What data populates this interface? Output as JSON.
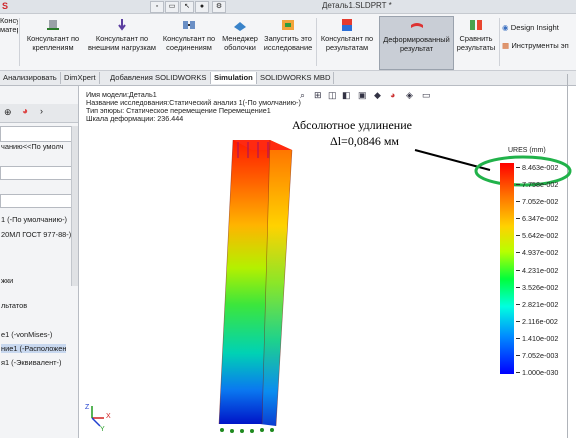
{
  "window": {
    "app_logo": "S",
    "title": "Деталь1.SLDPRT *"
  },
  "ribbon": {
    "left_cut_label": "Консультант\nматериал",
    "buttons": [
      {
        "label": "Консультант по\nкреплениям",
        "icon": "fixture-icon"
      },
      {
        "label": "Консультант по\nвнешним нагрузкам",
        "icon": "load-arrow-icon"
      },
      {
        "label": "Консультант по\nсоединениям",
        "icon": "connection-icon"
      },
      {
        "label": "Менеджер\nоболочки",
        "icon": "shell-icon"
      },
      {
        "label": "Запустить это\nисследование",
        "icon": "run-icon"
      },
      {
        "label": "Консультант по\nрезультатам",
        "icon": "results-icon"
      },
      {
        "label": "Деформированный\nрезультат",
        "icon": "deformed-icon"
      },
      {
        "label": "Сравнить\nрезультаты",
        "icon": "compare-icon"
      }
    ],
    "side_items": [
      "Design Insight",
      "Инструменты эп"
    ]
  },
  "tabs": [
    "Анализировать",
    "DimXpert",
    "Добавления SOLIDWORKS",
    "Simulation",
    "SOLIDWORKS MBD"
  ],
  "active_tab": "Simulation",
  "left_panel": {
    "items": [
      "чанию<<По умолч",
      "1 (-По умолчанию-)",
      "20МЛ ГОСТ 977-88-)",
      "жки",
      "льтатов",
      "е1 (-vonMises-)",
      "ние1 (-Расположен",
      "я1 (-Эквивалент-)"
    ],
    "selected_index": 6
  },
  "info": {
    "model": "Имя модели:Деталь1",
    "study": "Название исследования:Статический анализ 1(-По умолчанию-)",
    "plot": "Тип эпюры: Статическое перемещение Перемещение1",
    "scale": "Шкала деформации: 236.444"
  },
  "annotation": {
    "line1": "Абсолютное удлинение",
    "line2": "Δl=0,0846 мм"
  },
  "legend": {
    "title": "URES (mm)",
    "labels": [
      "8.463e-002",
      "7.758e-002",
      "7.052e-002",
      "6.347e-002",
      "5.642e-002",
      "4.937e-002",
      "4.231e-002",
      "3.526e-002",
      "2.821e-002",
      "2.116e-002",
      "1.410e-002",
      "7.052e-003",
      "1.000e-030"
    ],
    "max_highlight_color": "#21b24a"
  },
  "triad": {
    "x": "X",
    "y": "Y",
    "z": "Z"
  }
}
